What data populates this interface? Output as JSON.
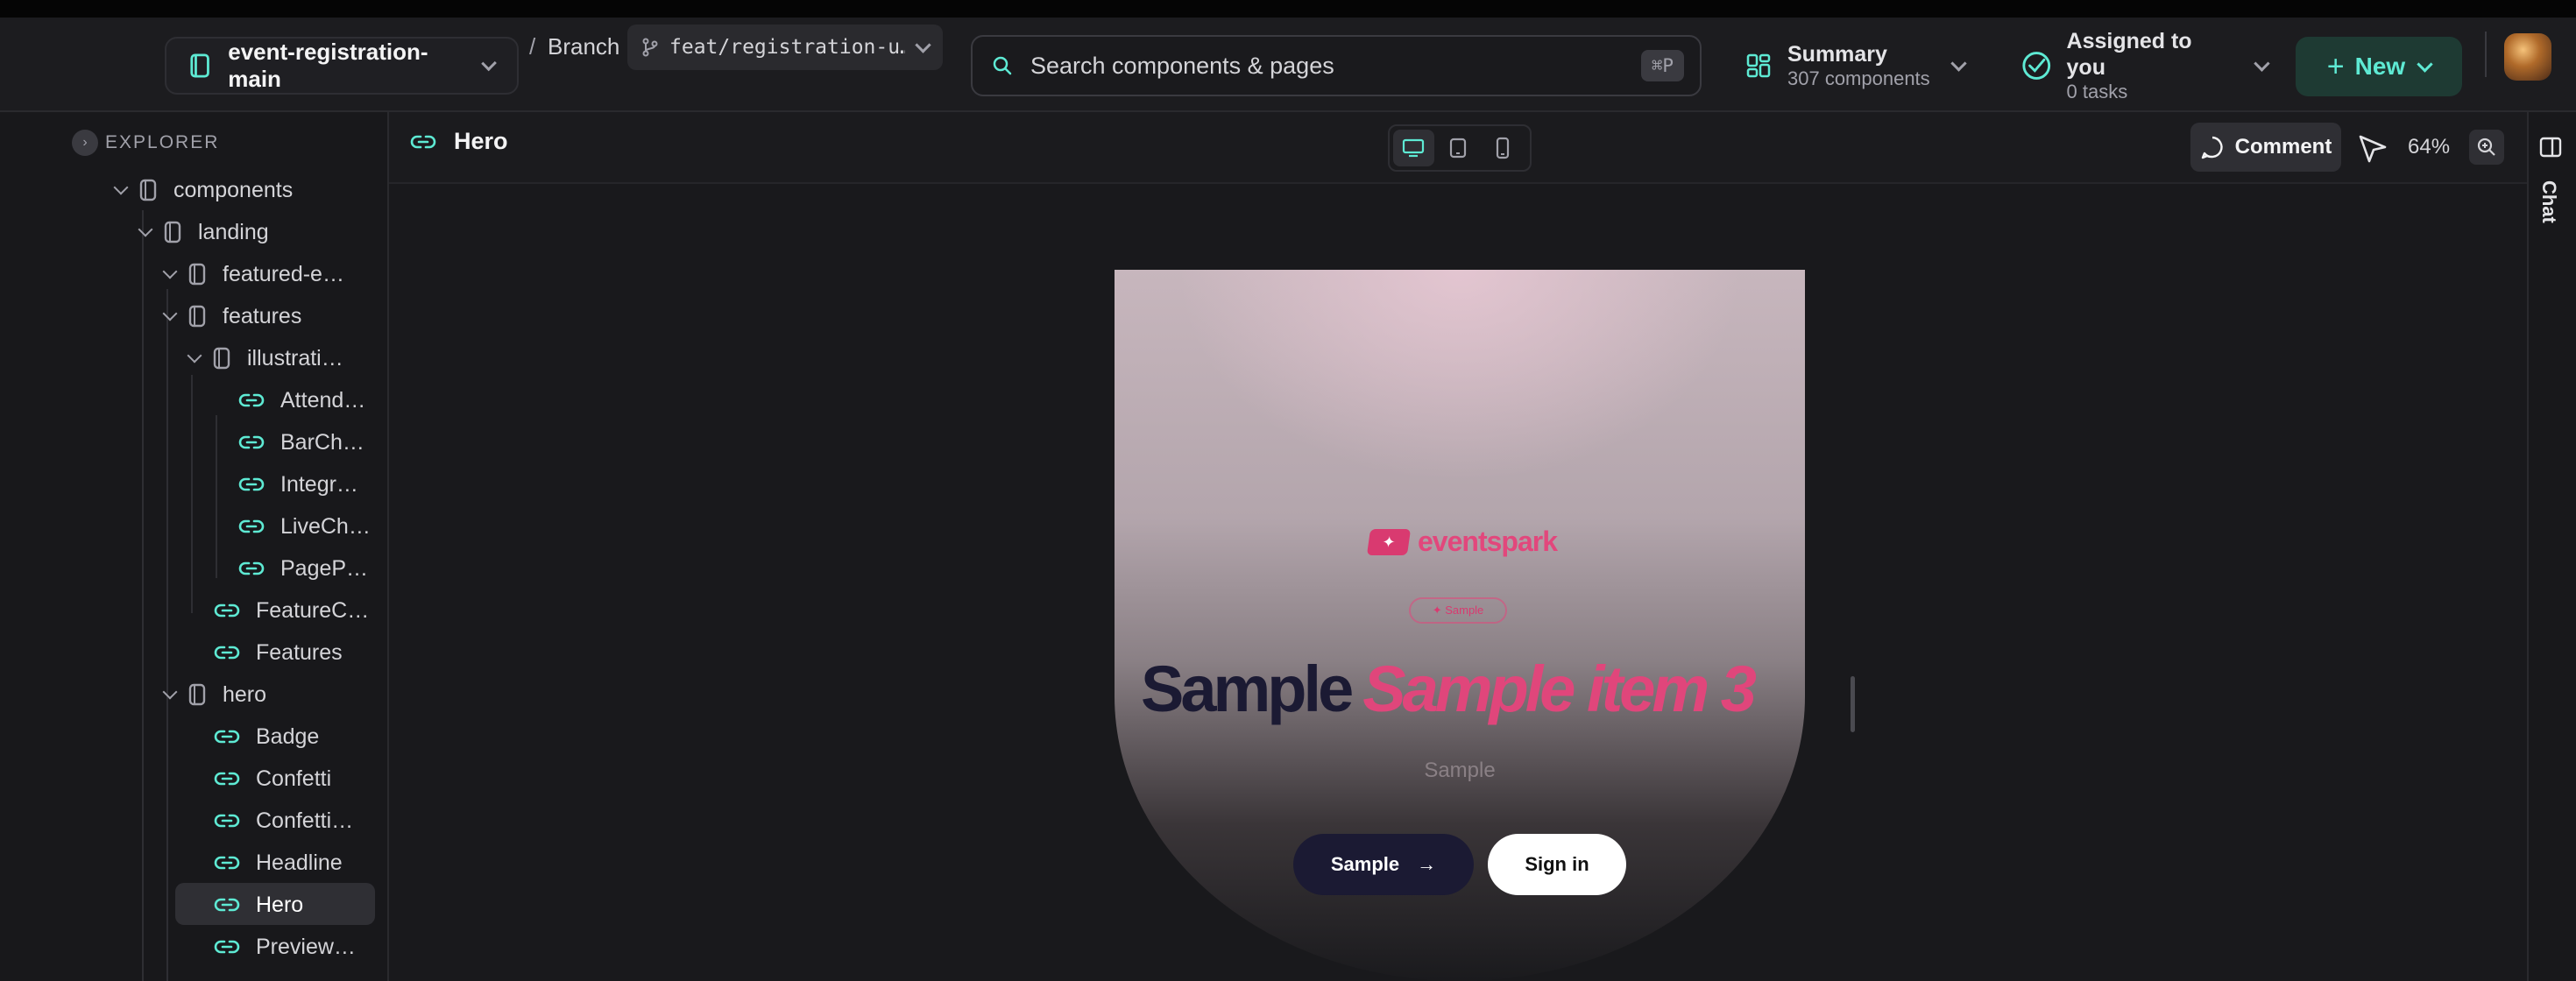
{
  "header": {
    "repo_name": "event-registration-main",
    "crumb_separator": "/",
    "branch_label": "Branch",
    "branch_name": "feat/registration-u…",
    "search_placeholder": "Search components & pages",
    "search_shortcut": "⌘P",
    "summary_title": "Summary",
    "summary_sub": "307 components",
    "assigned_title": "Assigned to you",
    "assigned_sub": "0 tasks",
    "new_label": "New"
  },
  "sidebar": {
    "explorer_label": "EXPLORER",
    "items": [
      {
        "label": "components",
        "kind": "folder"
      },
      {
        "label": "landing",
        "kind": "folder"
      },
      {
        "label": "featured-e…",
        "kind": "folder"
      },
      {
        "label": "features",
        "kind": "folder"
      },
      {
        "label": "illustrati…",
        "kind": "folder"
      },
      {
        "label": "Attend…",
        "kind": "component"
      },
      {
        "label": "BarCh…",
        "kind": "component"
      },
      {
        "label": "Integr…",
        "kind": "component"
      },
      {
        "label": "LiveCh…",
        "kind": "component"
      },
      {
        "label": "PageP…",
        "kind": "component"
      },
      {
        "label": "FeatureC…",
        "kind": "component"
      },
      {
        "label": "Features",
        "kind": "component"
      },
      {
        "label": "hero",
        "kind": "folder"
      },
      {
        "label": "Badge",
        "kind": "component"
      },
      {
        "label": "Confetti",
        "kind": "component"
      },
      {
        "label": "Confetti…",
        "kind": "component"
      },
      {
        "label": "Headline",
        "kind": "component"
      },
      {
        "label": "Hero",
        "kind": "component",
        "active": true
      },
      {
        "label": "Preview…",
        "kind": "component"
      }
    ]
  },
  "toolbar": {
    "page_title": "Hero",
    "comment_label": "Comment",
    "zoom": "64%"
  },
  "rail": {
    "chat_label": "Chat"
  },
  "preview": {
    "brand": "eventspark",
    "badge": "✦ Sample",
    "headline_part1": "Sample",
    "headline_part2": "Sample item 3",
    "subtitle": "Sample",
    "primary_button": "Sample",
    "secondary_button": "Sign in"
  },
  "colors": {
    "accent_teal": "#5eead4",
    "brand_pink": "#e0467b",
    "navy": "#1b1a33"
  }
}
